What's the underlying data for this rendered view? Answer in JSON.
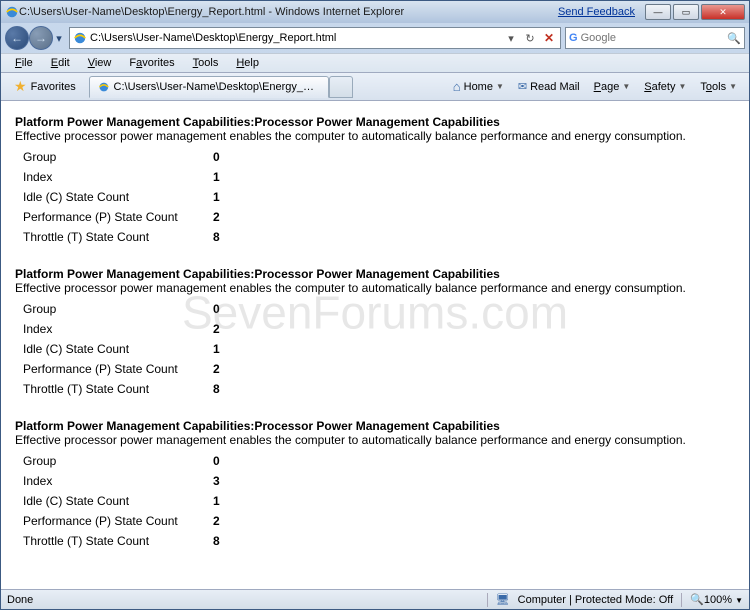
{
  "titlebar": {
    "title": "C:\\Users\\User-Name\\Desktop\\Energy_Report.html - Windows Internet Explorer",
    "feedback": "Send Feedback"
  },
  "address": {
    "path": "C:\\Users\\User-Name\\Desktop\\Energy_Report.html"
  },
  "search": {
    "placeholder": "Google"
  },
  "menu": {
    "file": "File",
    "edit": "Edit",
    "view": "View",
    "favorites": "Favorites",
    "tools": "Tools",
    "help": "Help"
  },
  "cmd": {
    "favorites": "Favorites",
    "tab_title": "C:\\Users\\User-Name\\Desktop\\Energy_Report.html",
    "home": "Home",
    "readmail": "Read Mail",
    "page": "Page",
    "safety": "Safety",
    "tools": "Tools"
  },
  "sections": [
    {
      "title": "Platform Power Management Capabilities:Processor Power Management Capabilities",
      "desc": "Effective processor power management enables the computer to automatically balance performance and energy consumption.",
      "rows": [
        {
          "label": "Group",
          "value": "0"
        },
        {
          "label": "Index",
          "value": "1"
        },
        {
          "label": "Idle (C) State Count",
          "value": "1"
        },
        {
          "label": "Performance (P) State Count",
          "value": "2"
        },
        {
          "label": "Throttle (T) State Count",
          "value": "8"
        }
      ]
    },
    {
      "title": "Platform Power Management Capabilities:Processor Power Management Capabilities",
      "desc": "Effective processor power management enables the computer to automatically balance performance and energy consumption.",
      "rows": [
        {
          "label": "Group",
          "value": "0"
        },
        {
          "label": "Index",
          "value": "2"
        },
        {
          "label": "Idle (C) State Count",
          "value": "1"
        },
        {
          "label": "Performance (P) State Count",
          "value": "2"
        },
        {
          "label": "Throttle (T) State Count",
          "value": "8"
        }
      ]
    },
    {
      "title": "Platform Power Management Capabilities:Processor Power Management Capabilities",
      "desc": "Effective processor power management enables the computer to automatically balance performance and energy consumption.",
      "rows": [
        {
          "label": "Group",
          "value": "0"
        },
        {
          "label": "Index",
          "value": "3"
        },
        {
          "label": "Idle (C) State Count",
          "value": "1"
        },
        {
          "label": "Performance (P) State Count",
          "value": "2"
        },
        {
          "label": "Throttle (T) State Count",
          "value": "8"
        }
      ]
    }
  ],
  "watermark": "SevenForums.com",
  "status": {
    "done": "Done",
    "zone": "Computer | Protected Mode: Off",
    "zoom": "100%"
  }
}
